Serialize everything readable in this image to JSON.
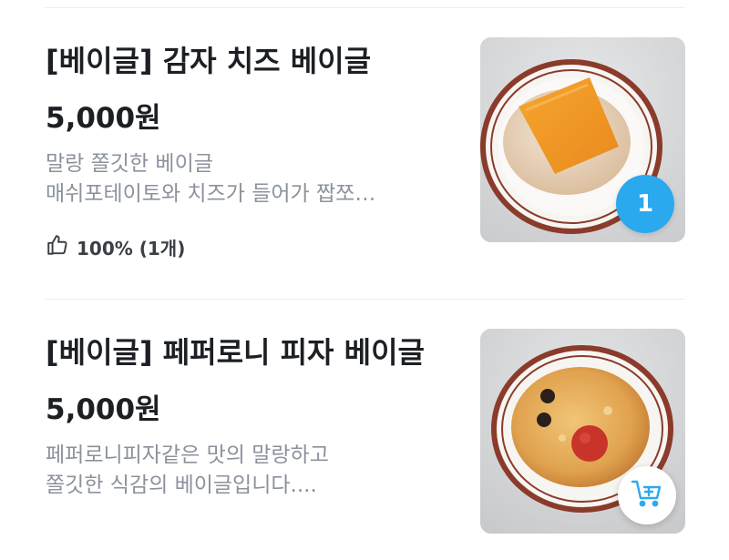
{
  "items": [
    {
      "title": "[베이글] 감자 치즈 베이글",
      "price": "5,000원",
      "description": [
        "말랑 쫄깃한 베이글",
        "매쉬포테이토와 치즈가 들어가 짭쪼…"
      ],
      "rating": "100% (1개)",
      "rating_icon": "thumbs-up-icon",
      "cart_quantity": "1",
      "image_alt": "potato cheese bagel on plate"
    },
    {
      "title": "[베이글] 페퍼로니 피자 베이글",
      "price": "5,000원",
      "description": [
        "페퍼로니피자같은 맛의 말랑하고",
        "쫄깃한 식감의 베이글입니다...."
      ],
      "add_to_cart_icon": "add-to-cart-icon",
      "image_alt": "pepperoni pizza bagel on plate"
    }
  ],
  "colors": {
    "accent": "#2aa9ef",
    "text_primary": "#1c1f24",
    "text_secondary": "#8b929c",
    "divider": "#eceef1"
  }
}
